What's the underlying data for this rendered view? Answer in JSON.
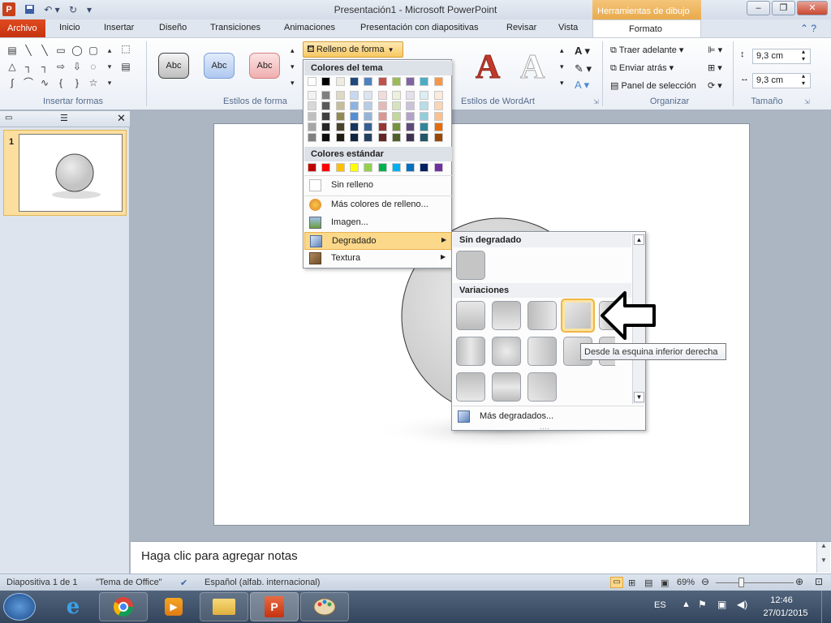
{
  "app": {
    "title": "Presentación1  -  Microsoft PowerPoint",
    "context_tab": "Herramientas de dibujo"
  },
  "tabs": [
    {
      "label": "Archivo"
    },
    {
      "label": "Inicio"
    },
    {
      "label": "Insertar"
    },
    {
      "label": "Diseño"
    },
    {
      "label": "Transiciones"
    },
    {
      "label": "Animaciones"
    },
    {
      "label": "Presentación con diapositivas"
    },
    {
      "label": "Revisar"
    },
    {
      "label": "Vista"
    },
    {
      "label": "Formato"
    }
  ],
  "ribbon": {
    "groups": {
      "insertar_formas": "Insertar formas",
      "estilos_forma": "Estilos de forma",
      "estilos_wordart": "Estilos de WordArt",
      "organizar": "Organizar",
      "tamano": "Tamaño"
    },
    "style_buttons": [
      "Abc",
      "Abc",
      "Abc"
    ],
    "wordart_letter": "A",
    "relleno_forma": "Relleno de forma",
    "organizar": {
      "traer_adelante": "Traer adelante",
      "enviar_atras": "Enviar atrás",
      "panel_seleccion": "Panel de selección"
    },
    "size": {
      "height": "9,3 cm",
      "width": "9,3 cm"
    }
  },
  "fill_menu": {
    "theme_header": "Colores del tema",
    "standard_header": "Colores estándar",
    "items": {
      "sin_relleno": "Sin relleno",
      "mas_colores": "Más colores de relleno...",
      "imagen": "Imagen...",
      "degradado": "Degradado",
      "textura": "Textura"
    },
    "theme_top": [
      "#ffffff",
      "#000000",
      "#eeece1",
      "#1f497d",
      "#4f81bd",
      "#c0504d",
      "#9bbb59",
      "#8064a2",
      "#4bacc6",
      "#f79646"
    ],
    "theme_shades": [
      [
        "#f2f2f2",
        "#7f7f7f",
        "#ddd9c3",
        "#c6d9f0",
        "#dbe5f1",
        "#f2dcdb",
        "#ebf1dd",
        "#e5e0ec",
        "#dbeef3",
        "#fdeada"
      ],
      [
        "#d8d8d8",
        "#595959",
        "#c4bd97",
        "#8db3e2",
        "#b8cce4",
        "#e5b9b7",
        "#d7e3bc",
        "#ccc1d9",
        "#b7dde8",
        "#fbd5b5"
      ],
      [
        "#bfbfbf",
        "#3f3f3f",
        "#938953",
        "#548dd4",
        "#95b3d7",
        "#d99694",
        "#c3d69b",
        "#b2a2c7",
        "#92cddc",
        "#fac08f"
      ],
      [
        "#a5a5a5",
        "#262626",
        "#494429",
        "#17365d",
        "#366092",
        "#953734",
        "#76923c",
        "#5f497a",
        "#31859b",
        "#e36c09"
      ],
      [
        "#7f7f7f",
        "#0c0c0c",
        "#1d1b10",
        "#0f243e",
        "#244061",
        "#632423",
        "#4f6128",
        "#3f3151",
        "#205867",
        "#974806"
      ]
    ],
    "standard": [
      "#c00000",
      "#ff0000",
      "#ffc000",
      "#ffff00",
      "#92d050",
      "#00b050",
      "#00b0f0",
      "#0070c0",
      "#002060",
      "#7030a0"
    ]
  },
  "gradient_menu": {
    "no_gradient_header": "Sin degradado",
    "variations_header": "Variaciones",
    "more": "Más degradados...",
    "tooltip": "Desde la esquina inferior derecha"
  },
  "notes": {
    "placeholder": "Haga clic para agregar notas"
  },
  "thumbnail": {
    "number": "1"
  },
  "status": {
    "slide": "Diapositiva 1 de 1",
    "theme": "\"Tema de Office\"",
    "language": "Español (alfab. internacional)",
    "zoom": "69%"
  },
  "taskbar": {
    "lang": "ES",
    "time": "12:46",
    "date": "27/01/2015"
  },
  "colors": {
    "accent_orange": "#e8a848",
    "file_tab": "#c5330f",
    "highlight": "#fcdf9f"
  }
}
